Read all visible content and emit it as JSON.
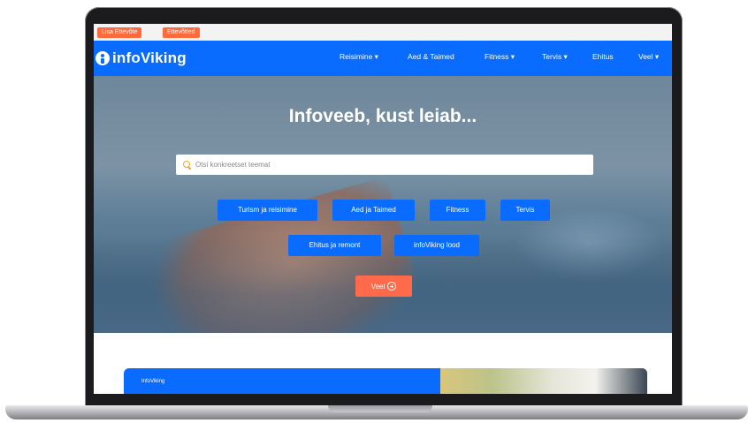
{
  "topbar": {
    "chips": [
      "Lisa Ettevõte",
      "Ettevõtted"
    ]
  },
  "header": {
    "logo_text": "infoViking",
    "nav": [
      "Reisimine ▾",
      "Aed & Taimed",
      "Fitness ▾",
      "Tervis ▾",
      "Ehitus",
      "Veel ▾"
    ]
  },
  "hero": {
    "title": "Infoveeb, kust leiab...",
    "search_placeholder": "Otsi konkreetset teemat",
    "categories_row1": [
      "Turism ja reisimine",
      "Aed ja Taimed",
      "Fitness",
      "Tervis"
    ],
    "categories_row2": [
      "Ehitus ja remont",
      "infoViking lood"
    ],
    "more_label": "Veel"
  },
  "section": {
    "card_label": "InfoViking"
  },
  "colors": {
    "brand_blue": "#0a6cff",
    "accent_orange": "#ff6a3d"
  }
}
